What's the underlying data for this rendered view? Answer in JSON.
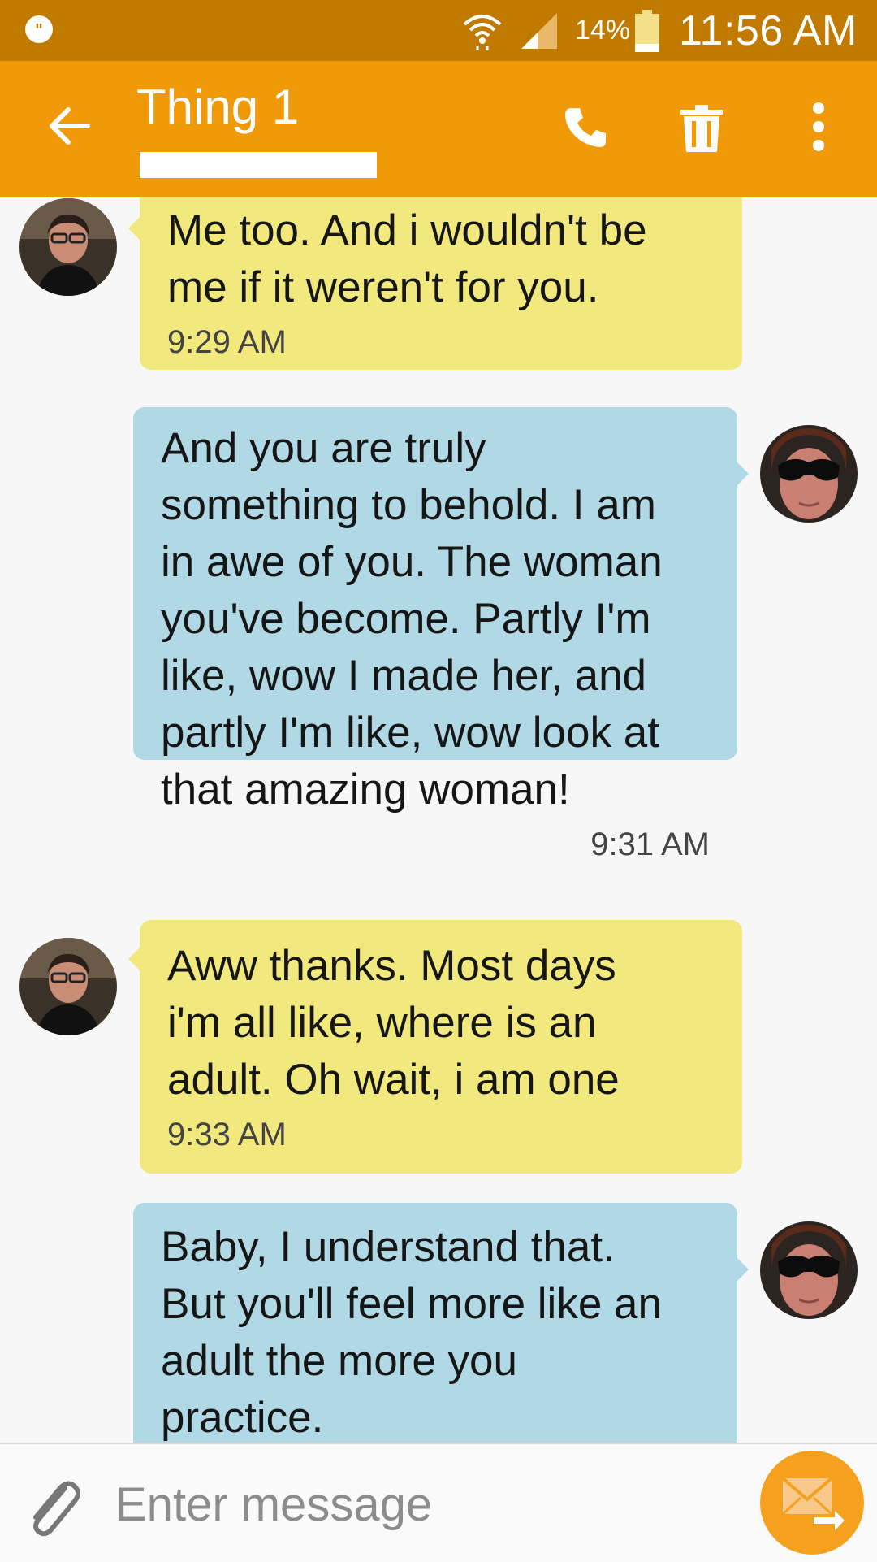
{
  "colors": {
    "status_bar": "#c17a00",
    "app_bar": "#f09a09",
    "incoming_bubble": "#f2e97e",
    "outgoing_bubble": "#b0d9e5",
    "send_button": "#f5a01f"
  },
  "status_bar": {
    "battery_percent": "14%",
    "time": "11:56 AM",
    "icons": [
      "hangouts-icon",
      "wifi-icon",
      "signal-icon",
      "battery-icon"
    ]
  },
  "app_bar": {
    "title": "Thing 1",
    "icons": [
      "back-arrow-icon",
      "phone-icon",
      "trash-icon",
      "more-vertical-icon"
    ]
  },
  "messages": [
    {
      "direction": "incoming",
      "text": "Me too. And i wouldn't be\nme if it weren't for you.",
      "time": "9:29 AM"
    },
    {
      "direction": "outgoing",
      "text": "And you are truly\nsomething to behold. I am\nin awe of you. The woman\nyou've become. Partly I'm\nlike, wow I made her, and\npartly I'm like, wow look at\nthat amazing woman!",
      "time": "9:31 AM"
    },
    {
      "direction": "incoming",
      "text": "Aww thanks. Most days\ni'm all like, where is an\nadult. Oh wait, i am one",
      "time": "9:33 AM"
    },
    {
      "direction": "outgoing",
      "text": "Baby, I understand that.\nBut you'll feel more like an\nadult the more you\npractice.",
      "time": ""
    }
  ],
  "compose": {
    "placeholder": "Enter message",
    "value": "",
    "icons": [
      "paperclip-icon",
      "send-message-icon"
    ]
  }
}
